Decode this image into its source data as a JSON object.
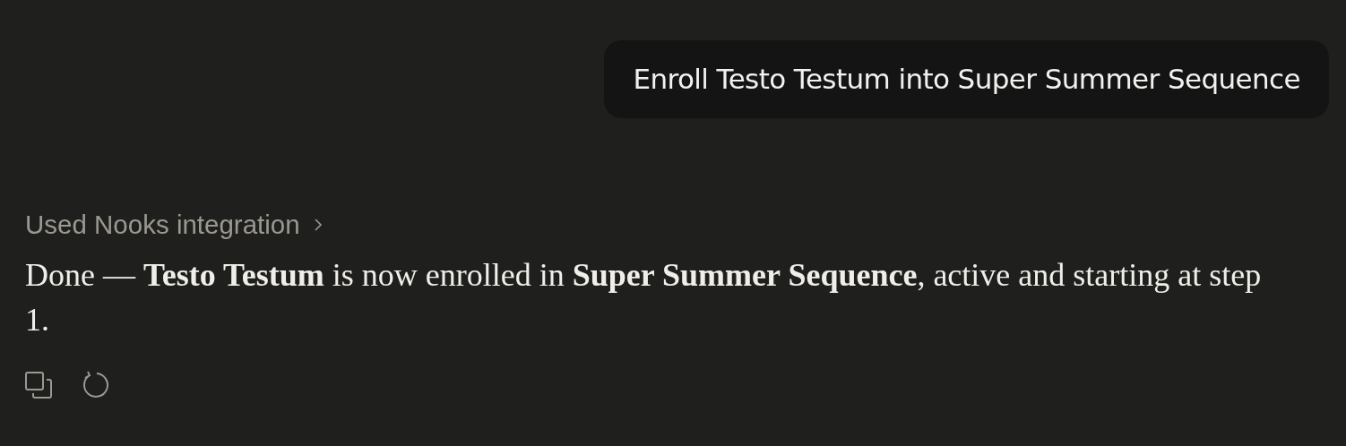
{
  "user_message": {
    "text": "Enroll Testo Testum into Super Summer Sequence"
  },
  "assistant_message": {
    "tool_use": {
      "label": "Used Nooks integration",
      "expanded": false
    },
    "text": "Done — **Testo Testum** is now enrolled in **Super Summer Sequence**, active and starting at step 1."
  }
}
